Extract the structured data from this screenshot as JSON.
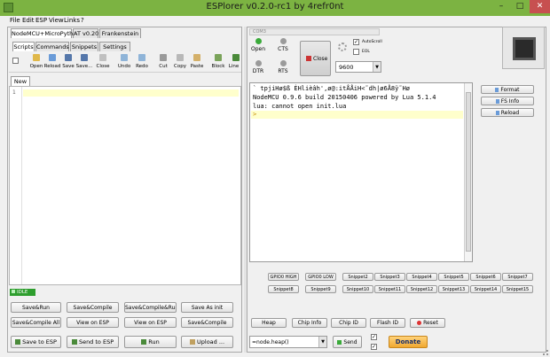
{
  "window": {
    "title": "ESPlorer v0.2.0-rc1 by 4refr0nt",
    "min": "–",
    "max": "□",
    "close": "✕"
  },
  "menu": [
    "File",
    "Edit",
    "ESP",
    "View",
    "Links",
    "?"
  ],
  "left": {
    "top_tabs": [
      "NodeMCU+MicroPython",
      "AT v0.20",
      "Frankenstein"
    ],
    "sub_tabs": [
      "Scripts",
      "Commands",
      "Snippets",
      "Settings"
    ],
    "toolbar": [
      "Open",
      "Reload",
      "Save",
      "Save...",
      "Close",
      "Undo",
      "Redo",
      "Cut",
      "Copy",
      "Paste",
      "Block",
      "Line"
    ],
    "file_tab": "New",
    "line_number": "1",
    "status": "IDLE",
    "buttons_row1": [
      "Save&Run",
      "Save&Compile",
      "Save&Compile&Run...",
      "Save As init"
    ],
    "buttons_row2": [
      "Save&Compile All",
      "View on ESP",
      "View on ESP",
      "Save&Compile"
    ],
    "buttons_row3": [
      "Save to ESP",
      "Send to ESP",
      "Run",
      "Upload ..."
    ]
  },
  "right": {
    "port_label": "COM3",
    "open": "Open",
    "cts": "CTS",
    "close_btn": "Close",
    "dtr": "DTR",
    "rts": "RTS",
    "autoscroll": "AutoScroll",
    "eol": "EOL",
    "baud": "9600",
    "terminal_lines": [
      "` tpjiHø$ß ÈHlièâh',ø@:itÅÅiH<˜dh|ø6Å8ÿ˜Hø",
      "NodeMCU 0.9.6 build 20150406  powered by Lua 5.1.4",
      "lua: cannot open init.lua",
      ">"
    ],
    "side_buttons": [
      "Format",
      "FS Info",
      "Reload"
    ],
    "snip_row1": [
      "GPIO0 HIGH",
      "GPIO0 LOW",
      "Snippet2",
      "Snippet3",
      "Snippet4",
      "Snippet5",
      "Snippet6",
      "Snippet7"
    ],
    "snip_row2": [
      "Snippet8",
      "Snippet9",
      "Snippet10",
      "Snippet11",
      "Snippet12",
      "Snippet13",
      "Snippet14",
      "Snippet15"
    ],
    "bottom_buttons": [
      "Heap",
      "Chip Info",
      "Chip ID",
      "Flash ID",
      "Reset"
    ],
    "command_value": "=node.heap()",
    "send": "Send",
    "donate": "Donate"
  },
  "colors": {
    "titlebar": "#7cb342",
    "close": "#c75050",
    "idle": "#2e9e2e",
    "donate": "#f0a830"
  }
}
